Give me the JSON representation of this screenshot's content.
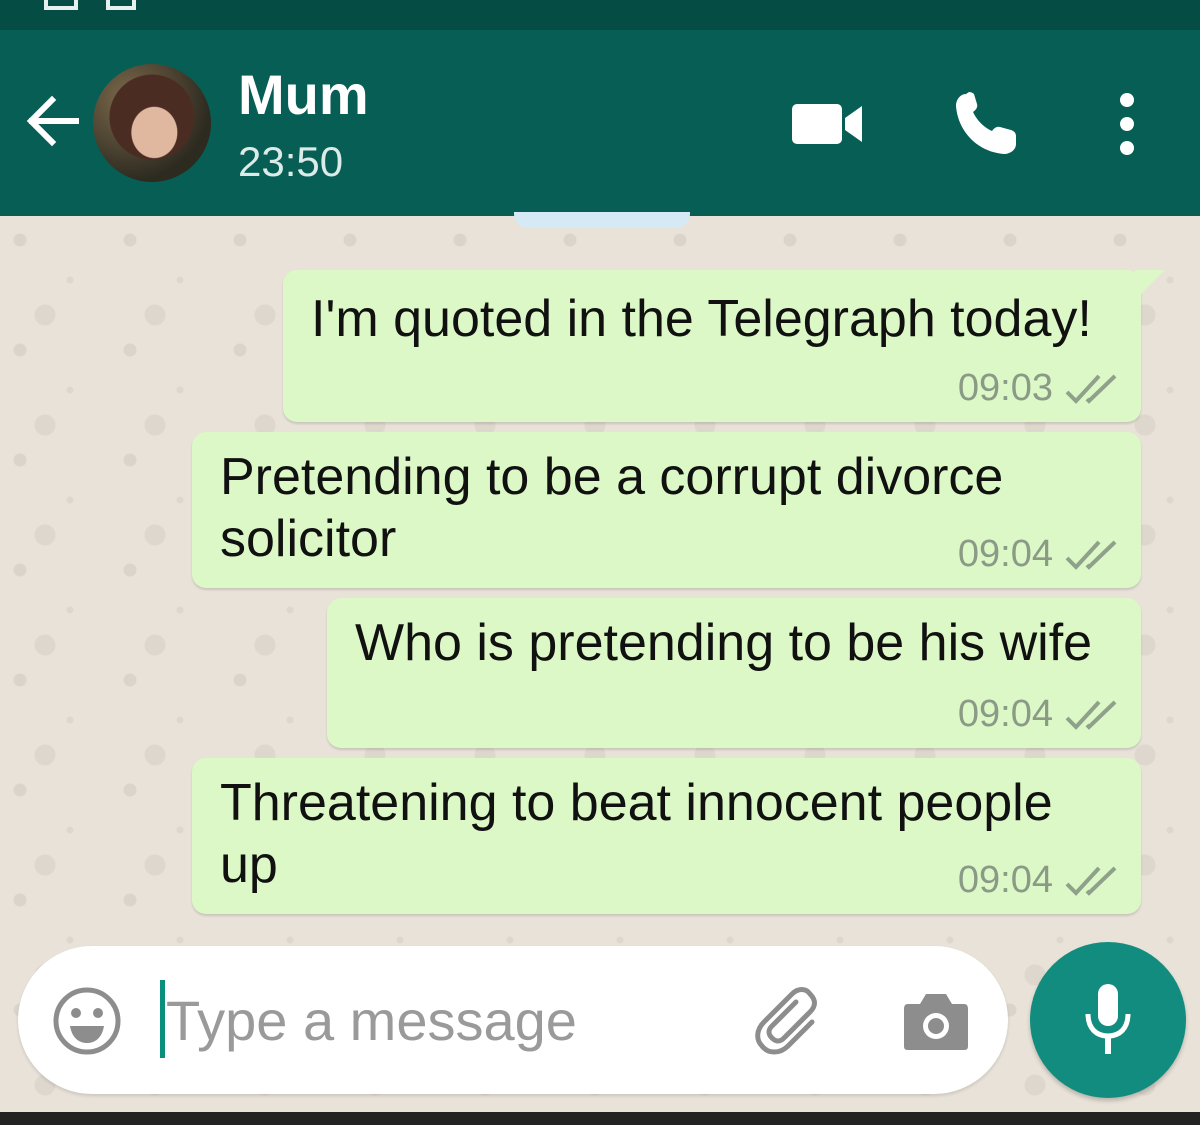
{
  "header": {
    "contact_name": "Mum",
    "last_seen": "23:50"
  },
  "messages": [
    {
      "text": "I'm quoted in the Telegraph today!",
      "time": "09:03",
      "status": "read-double-tick"
    },
    {
      "text": "Pretending to be a corrupt divorce solicitor",
      "time": "09:04",
      "status": "read-double-tick"
    },
    {
      "text": "Who is pretending to be his wife",
      "time": "09:04",
      "status": "read-double-tick"
    },
    {
      "text": "Threatening to beat innocent people up",
      "time": "09:04",
      "status": "read-double-tick"
    }
  ],
  "composer": {
    "placeholder": "Type a message"
  },
  "icons": {
    "back": "arrow-left-icon",
    "video": "video-camera-icon",
    "call": "phone-icon",
    "menu": "more-vertical-icon",
    "emoji": "emoji-icon",
    "attach": "paperclip-icon",
    "camera": "camera-icon",
    "mic": "microphone-icon"
  },
  "colors": {
    "header": "#075e54",
    "outgoing_bubble": "#dcf8c6",
    "accent": "#128c7e"
  }
}
